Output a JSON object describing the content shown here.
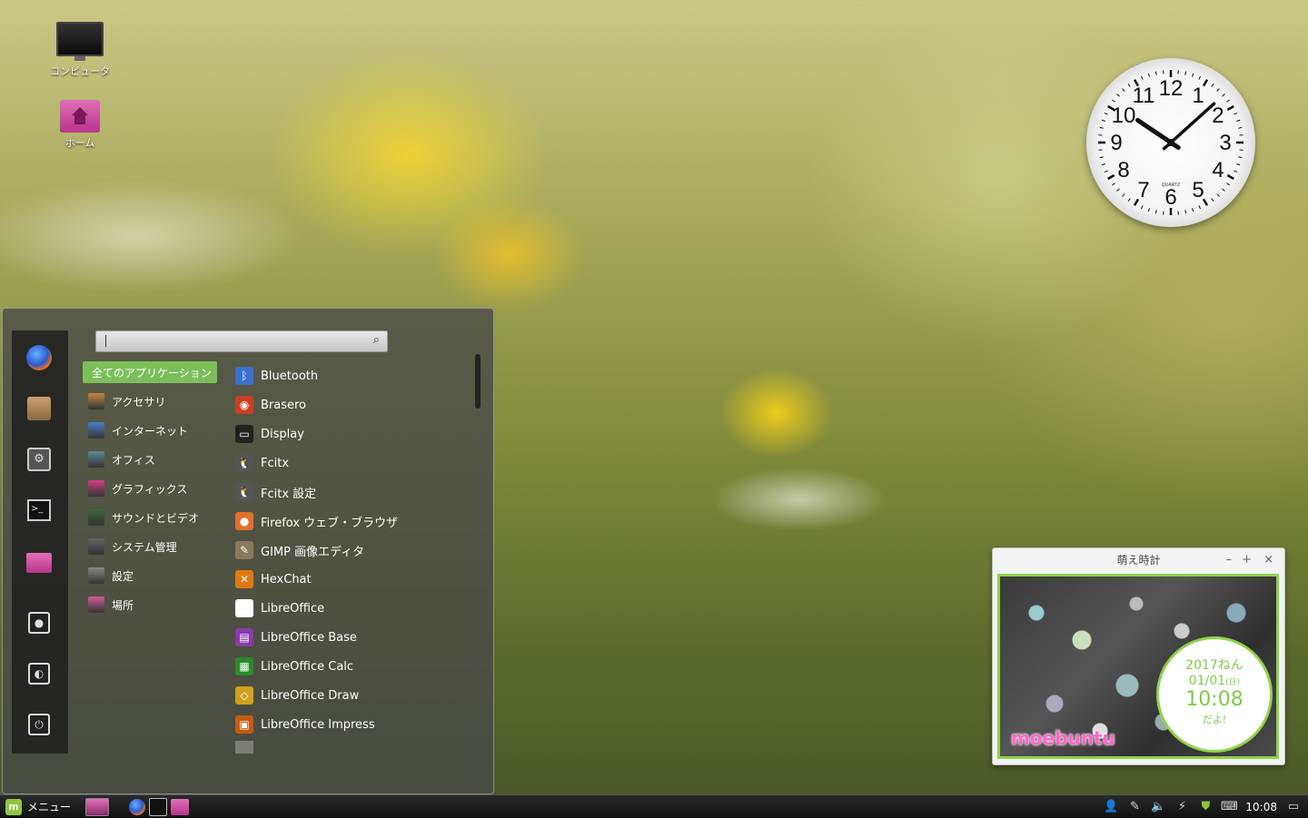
{
  "desktop": {
    "icons": [
      {
        "label": "コンピュータ",
        "icon": "computer-icon"
      },
      {
        "label": "ホーム",
        "icon": "home-folder-icon"
      }
    ]
  },
  "analog_clock": {
    "hour": 10,
    "minute": 8,
    "brand": "QUARTZ",
    "numerals": [
      "12",
      "1",
      "2",
      "3",
      "4",
      "5",
      "6",
      "7",
      "8",
      "9",
      "10",
      "11"
    ]
  },
  "menu": {
    "search": {
      "value": "",
      "placeholder": ""
    },
    "favorites": [
      "firefox-icon",
      "package-manager-icon",
      "system-settings-icon",
      "terminal-icon",
      "files-folder-icon",
      "lock-screen-icon",
      "logout-icon",
      "power-icon"
    ],
    "categories": [
      {
        "label": "全てのアプリケーション",
        "active": true,
        "color": ""
      },
      {
        "label": "アクセサリ",
        "color": "#c58a3a"
      },
      {
        "label": "インターネット",
        "color": "#4a7fc8"
      },
      {
        "label": "オフィス",
        "color": "#5a8a9a"
      },
      {
        "label": "グラフィックス",
        "color": "#d04080"
      },
      {
        "label": "サウンドとビデオ",
        "color": "#3a6a3a"
      },
      {
        "label": "システム管理",
        "color": "#666666"
      },
      {
        "label": "設定",
        "color": "#888888"
      },
      {
        "label": "場所",
        "color": "#d05a9a"
      }
    ],
    "applications": [
      {
        "label": "Bluetooth",
        "icon": "bluetooth-icon",
        "color": "#3a6fd0",
        "glyph": "ᛒ"
      },
      {
        "label": "Brasero",
        "icon": "brasero-icon",
        "color": "#c84020",
        "glyph": "◉"
      },
      {
        "label": "Display",
        "icon": "display-icon",
        "color": "#222222",
        "glyph": "▭"
      },
      {
        "label": "Fcitx",
        "icon": "fcitx-icon",
        "color": "#555555",
        "glyph": "🐧"
      },
      {
        "label": "Fcitx 設定",
        "icon": "fcitx-settings-icon",
        "color": "#555555",
        "glyph": "🐧"
      },
      {
        "label": "Firefox ウェブ・ブラウザ",
        "icon": "firefox-icon",
        "color": "#e0702a",
        "glyph": "●"
      },
      {
        "label": "GIMP 画像エディタ",
        "icon": "gimp-icon",
        "color": "#8a7a5a",
        "glyph": "✎"
      },
      {
        "label": "HexChat",
        "icon": "hexchat-icon",
        "color": "#e07a10",
        "glyph": "✕"
      },
      {
        "label": "LibreOffice",
        "icon": "libreoffice-icon",
        "color": "#ffffff",
        "glyph": ""
      },
      {
        "label": "LibreOffice Base",
        "icon": "libreoffice-base-icon",
        "color": "#8a3aa8",
        "glyph": "▤"
      },
      {
        "label": "LibreOffice Calc",
        "icon": "libreoffice-calc-icon",
        "color": "#2a8a2a",
        "glyph": "▦"
      },
      {
        "label": "LibreOffice Draw",
        "icon": "libreoffice-draw-icon",
        "color": "#d0a020",
        "glyph": "◇"
      },
      {
        "label": "LibreOffice Impress",
        "icon": "libreoffice-impress-icon",
        "color": "#c85a10",
        "glyph": "▣"
      }
    ]
  },
  "moe_clock": {
    "title": "萌え時計",
    "buttons": {
      "minimize": "–",
      "maximize": "+",
      "close": "×"
    },
    "year": "2017ねん",
    "date": "01/01",
    "weekday": "(日)",
    "time": "10:08",
    "suffix": "だよ!",
    "brand": "moebuntu",
    "accent": "#8ed34a"
  },
  "taskbar": {
    "menu_label": "メニュー",
    "mint_logo": "m",
    "clock": "10:08",
    "launchers": [
      "desktop-icon",
      "firefox-icon",
      "terminal-icon",
      "files-folder-icon"
    ],
    "tray": [
      "user-icon",
      "pen-icon",
      "volume-icon",
      "network-icon",
      "update-shield-icon",
      "keyboard-icon"
    ]
  }
}
